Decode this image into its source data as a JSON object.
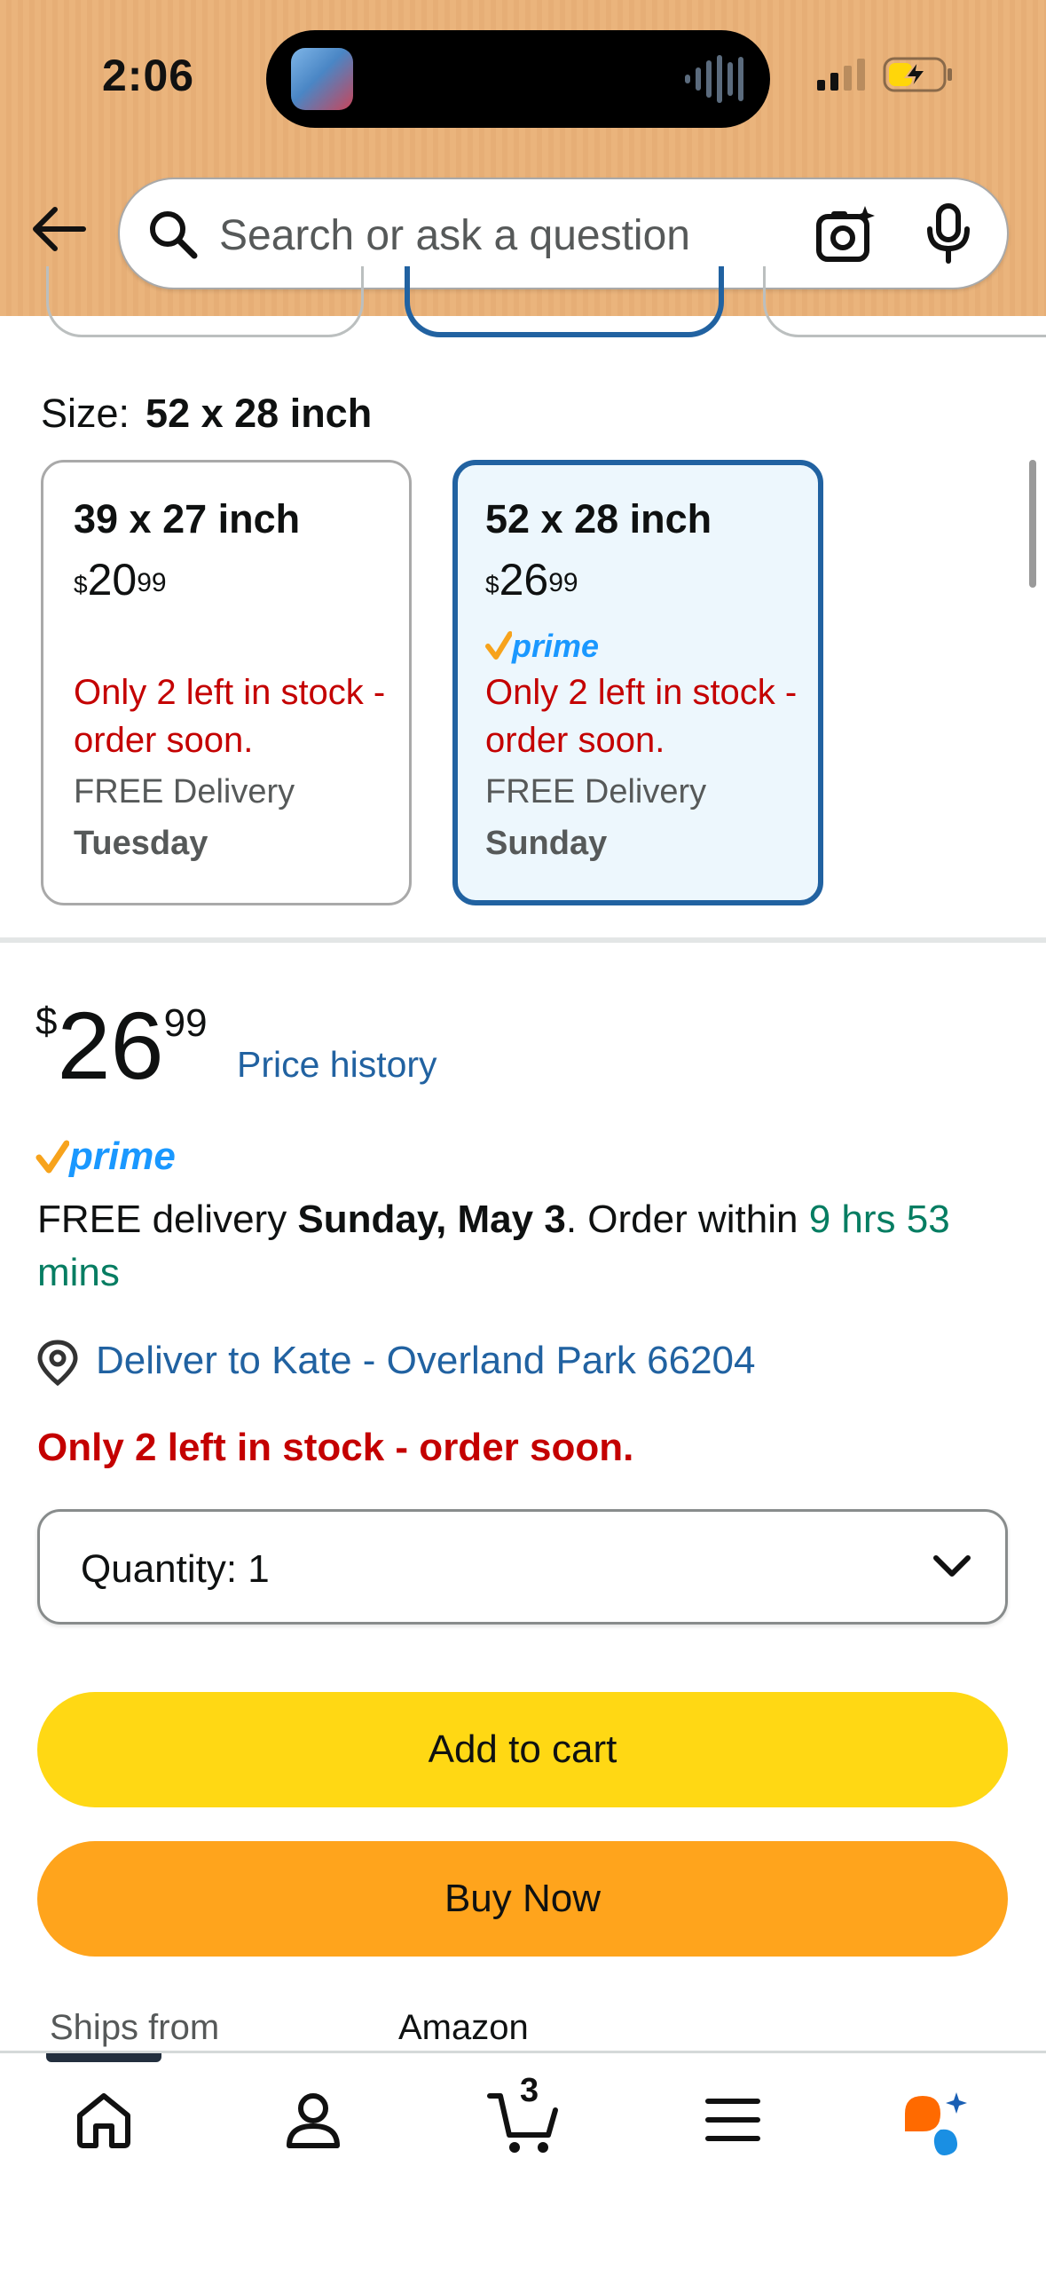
{
  "status_bar": {
    "time": "2:06"
  },
  "search": {
    "placeholder": "Search or ask a question"
  },
  "size": {
    "label": "Size:",
    "selected_value": "52 x 28 inch",
    "options": [
      {
        "title": "39 x 27 inch",
        "price_currency": "$",
        "price_whole": "20",
        "price_fraction": "99",
        "prime": false,
        "stock": "Only 2 left in stock - order soon.",
        "delivery": "FREE Delivery",
        "day": "Tuesday",
        "selected": false
      },
      {
        "title": "52 x 28 inch",
        "price_currency": "$",
        "price_whole": "26",
        "price_fraction": "99",
        "prime": true,
        "prime_label": "prime",
        "stock": "Only 2 left in stock - order soon.",
        "delivery": "FREE Delivery",
        "day": "Sunday",
        "selected": true
      }
    ]
  },
  "price": {
    "currency": "$",
    "whole": "26",
    "fraction": "99",
    "history_link": "Price history"
  },
  "prime_label": "prime",
  "delivery": {
    "prefix": "FREE delivery ",
    "date": "Sunday, May 3",
    "middle": ". Order within ",
    "countdown": "9 hrs 53 mins"
  },
  "deliver_to": "Deliver to Kate - Overland Park 66204",
  "stock_message": "Only 2 left in stock - order soon.",
  "quantity": {
    "label": "Quantity: 1"
  },
  "buttons": {
    "add_to_cart": "Add to cart",
    "buy_now": "Buy Now"
  },
  "ships_from": {
    "label": "Ships from",
    "value": "Amazon"
  },
  "nav": {
    "cart_count": "3"
  },
  "colors": {
    "header_bg": "#eab47c",
    "link_blue": "#2162a1",
    "stock_red": "#c40000",
    "countdown_green": "#067d62",
    "add_to_cart": "#ffd814",
    "buy_now": "#ffa41c",
    "prime_blue": "#1a98ff",
    "prime_check": "#f7a31c"
  }
}
